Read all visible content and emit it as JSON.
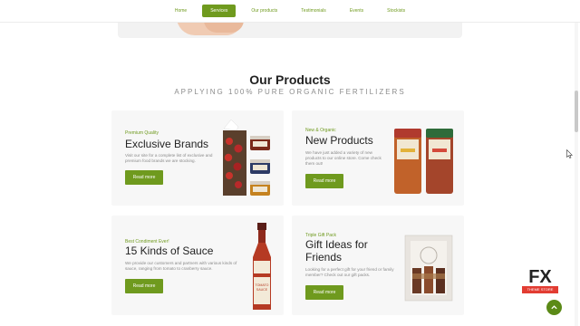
{
  "nav": {
    "items": [
      {
        "label": "Home"
      },
      {
        "label": "Services"
      },
      {
        "label": "Our products"
      },
      {
        "label": "Testimonials"
      },
      {
        "label": "Events"
      },
      {
        "label": "Stockists"
      }
    ],
    "active_index": 1
  },
  "section": {
    "title": "Our Products",
    "subtitle": "APPLYING 100% PURE ORGANIC FERTILIZERS"
  },
  "products": [
    {
      "kicker": "Premium Quality",
      "title": "Exclusive Brands",
      "desc": "Visit our site for a complete list of exclusive and premium food brands we are stocking.",
      "button": "Read more"
    },
    {
      "kicker": "New & Organic",
      "title": "New Products",
      "desc": "We have just added a variety of new products to our online store. Come check them out!",
      "button": "Read more"
    },
    {
      "kicker": "Best Condiment Ever!",
      "title": "15 Kinds of Sauce",
      "desc": "We provide our customers and partners with various kinds of sauce, ranging from tomato to cranberry sauce.",
      "button": "Read more"
    },
    {
      "kicker": "Triple Gift Pack",
      "title": "Gift Ideas for Friends",
      "desc": "Looking for a perfect gift for your friend or family member? Check out our gift packs.",
      "button": "Read more"
    }
  ],
  "badge": {
    "letters": "FX",
    "caption": "THEME STORE"
  },
  "icons": {
    "to_top": "chevron-up-icon",
    "cursor": "mouse-cursor-icon"
  },
  "colors": {
    "accent": "#6f9a1e",
    "card_bg": "#f7f7f7",
    "badge_red": "#e23c32"
  },
  "bottle_label": {
    "top": "TOMATO",
    "bottom": "SAUCE"
  }
}
